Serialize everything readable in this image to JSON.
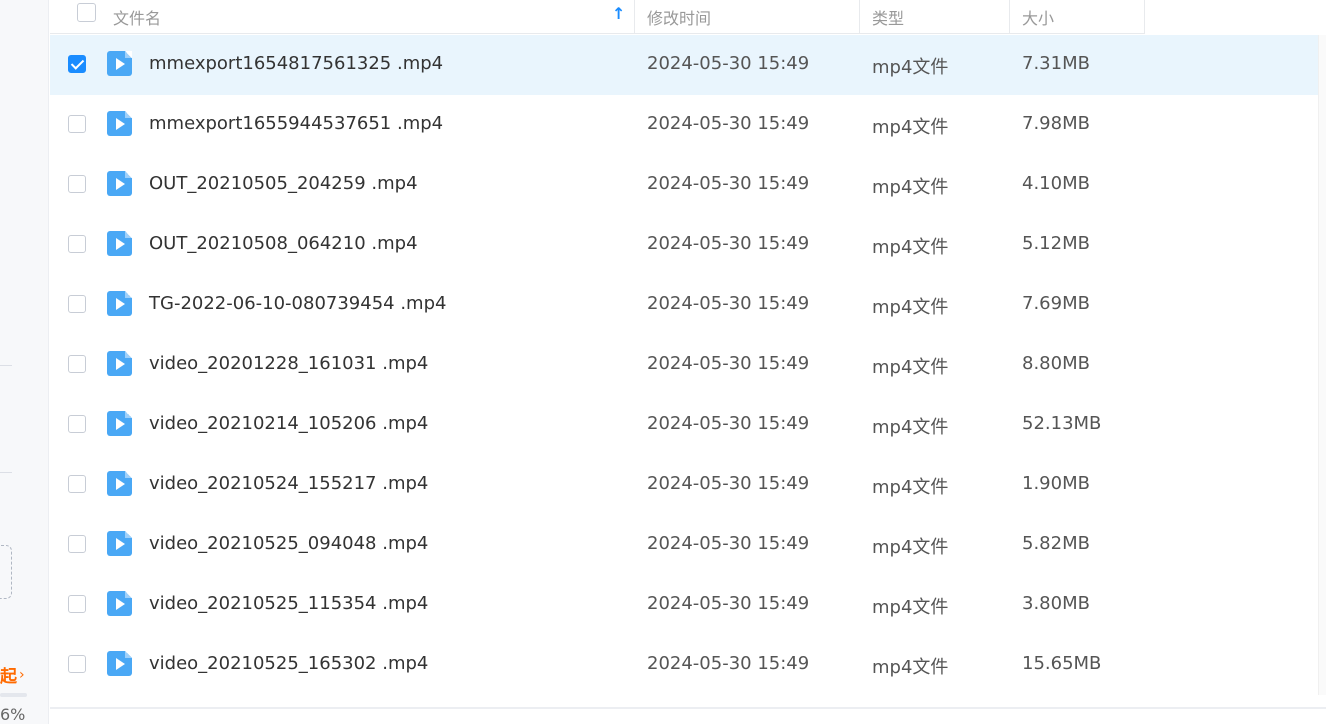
{
  "sidebar": {
    "promo_label": "起",
    "promo_arrow": "›",
    "percent_label": "6%"
  },
  "header": {
    "col_name": "文件名",
    "col_time": "修改时间",
    "col_type": "类型",
    "col_size": "大小",
    "sort_arrow": "↑"
  },
  "files": [
    {
      "name": "mmexport1654817561325 .mp4",
      "time": "2024-05-30 15:49",
      "type": "mp4文件",
      "size": "7.31MB",
      "checked": true
    },
    {
      "name": "mmexport1655944537651 .mp4",
      "time": "2024-05-30 15:49",
      "type": "mp4文件",
      "size": "7.98MB",
      "checked": false
    },
    {
      "name": "OUT_20210505_204259 .mp4",
      "time": "2024-05-30 15:49",
      "type": "mp4文件",
      "size": "4.10MB",
      "checked": false
    },
    {
      "name": "OUT_20210508_064210 .mp4",
      "time": "2024-05-30 15:49",
      "type": "mp4文件",
      "size": "5.12MB",
      "checked": false
    },
    {
      "name": "TG-2022-06-10-080739454 .mp4",
      "time": "2024-05-30 15:49",
      "type": "mp4文件",
      "size": "7.69MB",
      "checked": false
    },
    {
      "name": "video_20201228_161031 .mp4",
      "time": "2024-05-30 15:49",
      "type": "mp4文件",
      "size": "8.80MB",
      "checked": false
    },
    {
      "name": "video_20210214_105206 .mp4",
      "time": "2024-05-30 15:49",
      "type": "mp4文件",
      "size": "52.13MB",
      "checked": false
    },
    {
      "name": "video_20210524_155217 .mp4",
      "time": "2024-05-30 15:49",
      "type": "mp4文件",
      "size": "1.90MB",
      "checked": false
    },
    {
      "name": "video_20210525_094048 .mp4",
      "time": "2024-05-30 15:49",
      "type": "mp4文件",
      "size": "5.82MB",
      "checked": false
    },
    {
      "name": "video_20210525_115354 .mp4",
      "time": "2024-05-30 15:49",
      "type": "mp4文件",
      "size": "3.80MB",
      "checked": false
    },
    {
      "name": "video_20210525_165302 .mp4",
      "time": "2024-05-30 15:49",
      "type": "mp4文件",
      "size": "15.65MB",
      "checked": false
    }
  ],
  "colors": {
    "accent": "#1a8cff",
    "selected_row": "#e9f5fd",
    "file_icon": "#4aa8f5",
    "promo": "#ff6a00"
  },
  "icons": {
    "file_icon": "video-file-icon",
    "sort_icon": "sort-ascending-icon"
  }
}
